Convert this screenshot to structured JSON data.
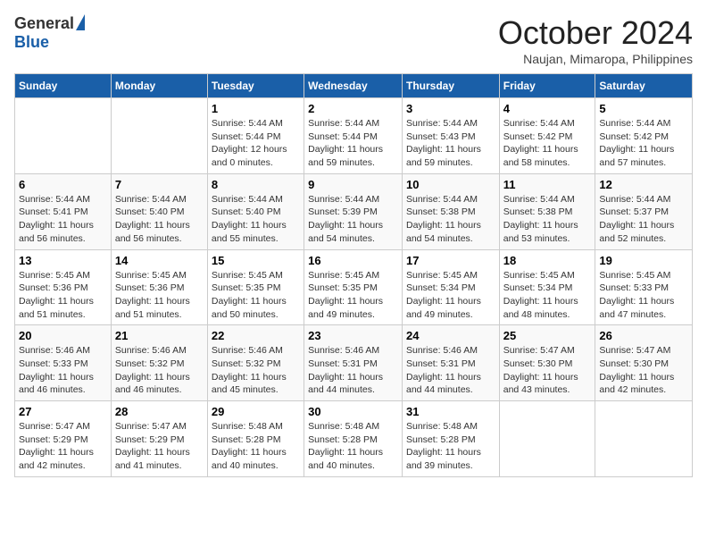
{
  "logo": {
    "general": "General",
    "blue": "Blue"
  },
  "title": "October 2024",
  "subtitle": "Naujan, Mimaropa, Philippines",
  "headers": [
    "Sunday",
    "Monday",
    "Tuesday",
    "Wednesday",
    "Thursday",
    "Friday",
    "Saturday"
  ],
  "weeks": [
    [
      {
        "day": "",
        "info": ""
      },
      {
        "day": "",
        "info": ""
      },
      {
        "day": "1",
        "info": "Sunrise: 5:44 AM\nSunset: 5:44 PM\nDaylight: 12 hours\nand 0 minutes."
      },
      {
        "day": "2",
        "info": "Sunrise: 5:44 AM\nSunset: 5:44 PM\nDaylight: 11 hours\nand 59 minutes."
      },
      {
        "day": "3",
        "info": "Sunrise: 5:44 AM\nSunset: 5:43 PM\nDaylight: 11 hours\nand 59 minutes."
      },
      {
        "day": "4",
        "info": "Sunrise: 5:44 AM\nSunset: 5:42 PM\nDaylight: 11 hours\nand 58 minutes."
      },
      {
        "day": "5",
        "info": "Sunrise: 5:44 AM\nSunset: 5:42 PM\nDaylight: 11 hours\nand 57 minutes."
      }
    ],
    [
      {
        "day": "6",
        "info": "Sunrise: 5:44 AM\nSunset: 5:41 PM\nDaylight: 11 hours\nand 56 minutes."
      },
      {
        "day": "7",
        "info": "Sunrise: 5:44 AM\nSunset: 5:40 PM\nDaylight: 11 hours\nand 56 minutes."
      },
      {
        "day": "8",
        "info": "Sunrise: 5:44 AM\nSunset: 5:40 PM\nDaylight: 11 hours\nand 55 minutes."
      },
      {
        "day": "9",
        "info": "Sunrise: 5:44 AM\nSunset: 5:39 PM\nDaylight: 11 hours\nand 54 minutes."
      },
      {
        "day": "10",
        "info": "Sunrise: 5:44 AM\nSunset: 5:38 PM\nDaylight: 11 hours\nand 54 minutes."
      },
      {
        "day": "11",
        "info": "Sunrise: 5:44 AM\nSunset: 5:38 PM\nDaylight: 11 hours\nand 53 minutes."
      },
      {
        "day": "12",
        "info": "Sunrise: 5:44 AM\nSunset: 5:37 PM\nDaylight: 11 hours\nand 52 minutes."
      }
    ],
    [
      {
        "day": "13",
        "info": "Sunrise: 5:45 AM\nSunset: 5:36 PM\nDaylight: 11 hours\nand 51 minutes."
      },
      {
        "day": "14",
        "info": "Sunrise: 5:45 AM\nSunset: 5:36 PM\nDaylight: 11 hours\nand 51 minutes."
      },
      {
        "day": "15",
        "info": "Sunrise: 5:45 AM\nSunset: 5:35 PM\nDaylight: 11 hours\nand 50 minutes."
      },
      {
        "day": "16",
        "info": "Sunrise: 5:45 AM\nSunset: 5:35 PM\nDaylight: 11 hours\nand 49 minutes."
      },
      {
        "day": "17",
        "info": "Sunrise: 5:45 AM\nSunset: 5:34 PM\nDaylight: 11 hours\nand 49 minutes."
      },
      {
        "day": "18",
        "info": "Sunrise: 5:45 AM\nSunset: 5:34 PM\nDaylight: 11 hours\nand 48 minutes."
      },
      {
        "day": "19",
        "info": "Sunrise: 5:45 AM\nSunset: 5:33 PM\nDaylight: 11 hours\nand 47 minutes."
      }
    ],
    [
      {
        "day": "20",
        "info": "Sunrise: 5:46 AM\nSunset: 5:33 PM\nDaylight: 11 hours\nand 46 minutes."
      },
      {
        "day": "21",
        "info": "Sunrise: 5:46 AM\nSunset: 5:32 PM\nDaylight: 11 hours\nand 46 minutes."
      },
      {
        "day": "22",
        "info": "Sunrise: 5:46 AM\nSunset: 5:32 PM\nDaylight: 11 hours\nand 45 minutes."
      },
      {
        "day": "23",
        "info": "Sunrise: 5:46 AM\nSunset: 5:31 PM\nDaylight: 11 hours\nand 44 minutes."
      },
      {
        "day": "24",
        "info": "Sunrise: 5:46 AM\nSunset: 5:31 PM\nDaylight: 11 hours\nand 44 minutes."
      },
      {
        "day": "25",
        "info": "Sunrise: 5:47 AM\nSunset: 5:30 PM\nDaylight: 11 hours\nand 43 minutes."
      },
      {
        "day": "26",
        "info": "Sunrise: 5:47 AM\nSunset: 5:30 PM\nDaylight: 11 hours\nand 42 minutes."
      }
    ],
    [
      {
        "day": "27",
        "info": "Sunrise: 5:47 AM\nSunset: 5:29 PM\nDaylight: 11 hours\nand 42 minutes."
      },
      {
        "day": "28",
        "info": "Sunrise: 5:47 AM\nSunset: 5:29 PM\nDaylight: 11 hours\nand 41 minutes."
      },
      {
        "day": "29",
        "info": "Sunrise: 5:48 AM\nSunset: 5:28 PM\nDaylight: 11 hours\nand 40 minutes."
      },
      {
        "day": "30",
        "info": "Sunrise: 5:48 AM\nSunset: 5:28 PM\nDaylight: 11 hours\nand 40 minutes."
      },
      {
        "day": "31",
        "info": "Sunrise: 5:48 AM\nSunset: 5:28 PM\nDaylight: 11 hours\nand 39 minutes."
      },
      {
        "day": "",
        "info": ""
      },
      {
        "day": "",
        "info": ""
      }
    ]
  ]
}
